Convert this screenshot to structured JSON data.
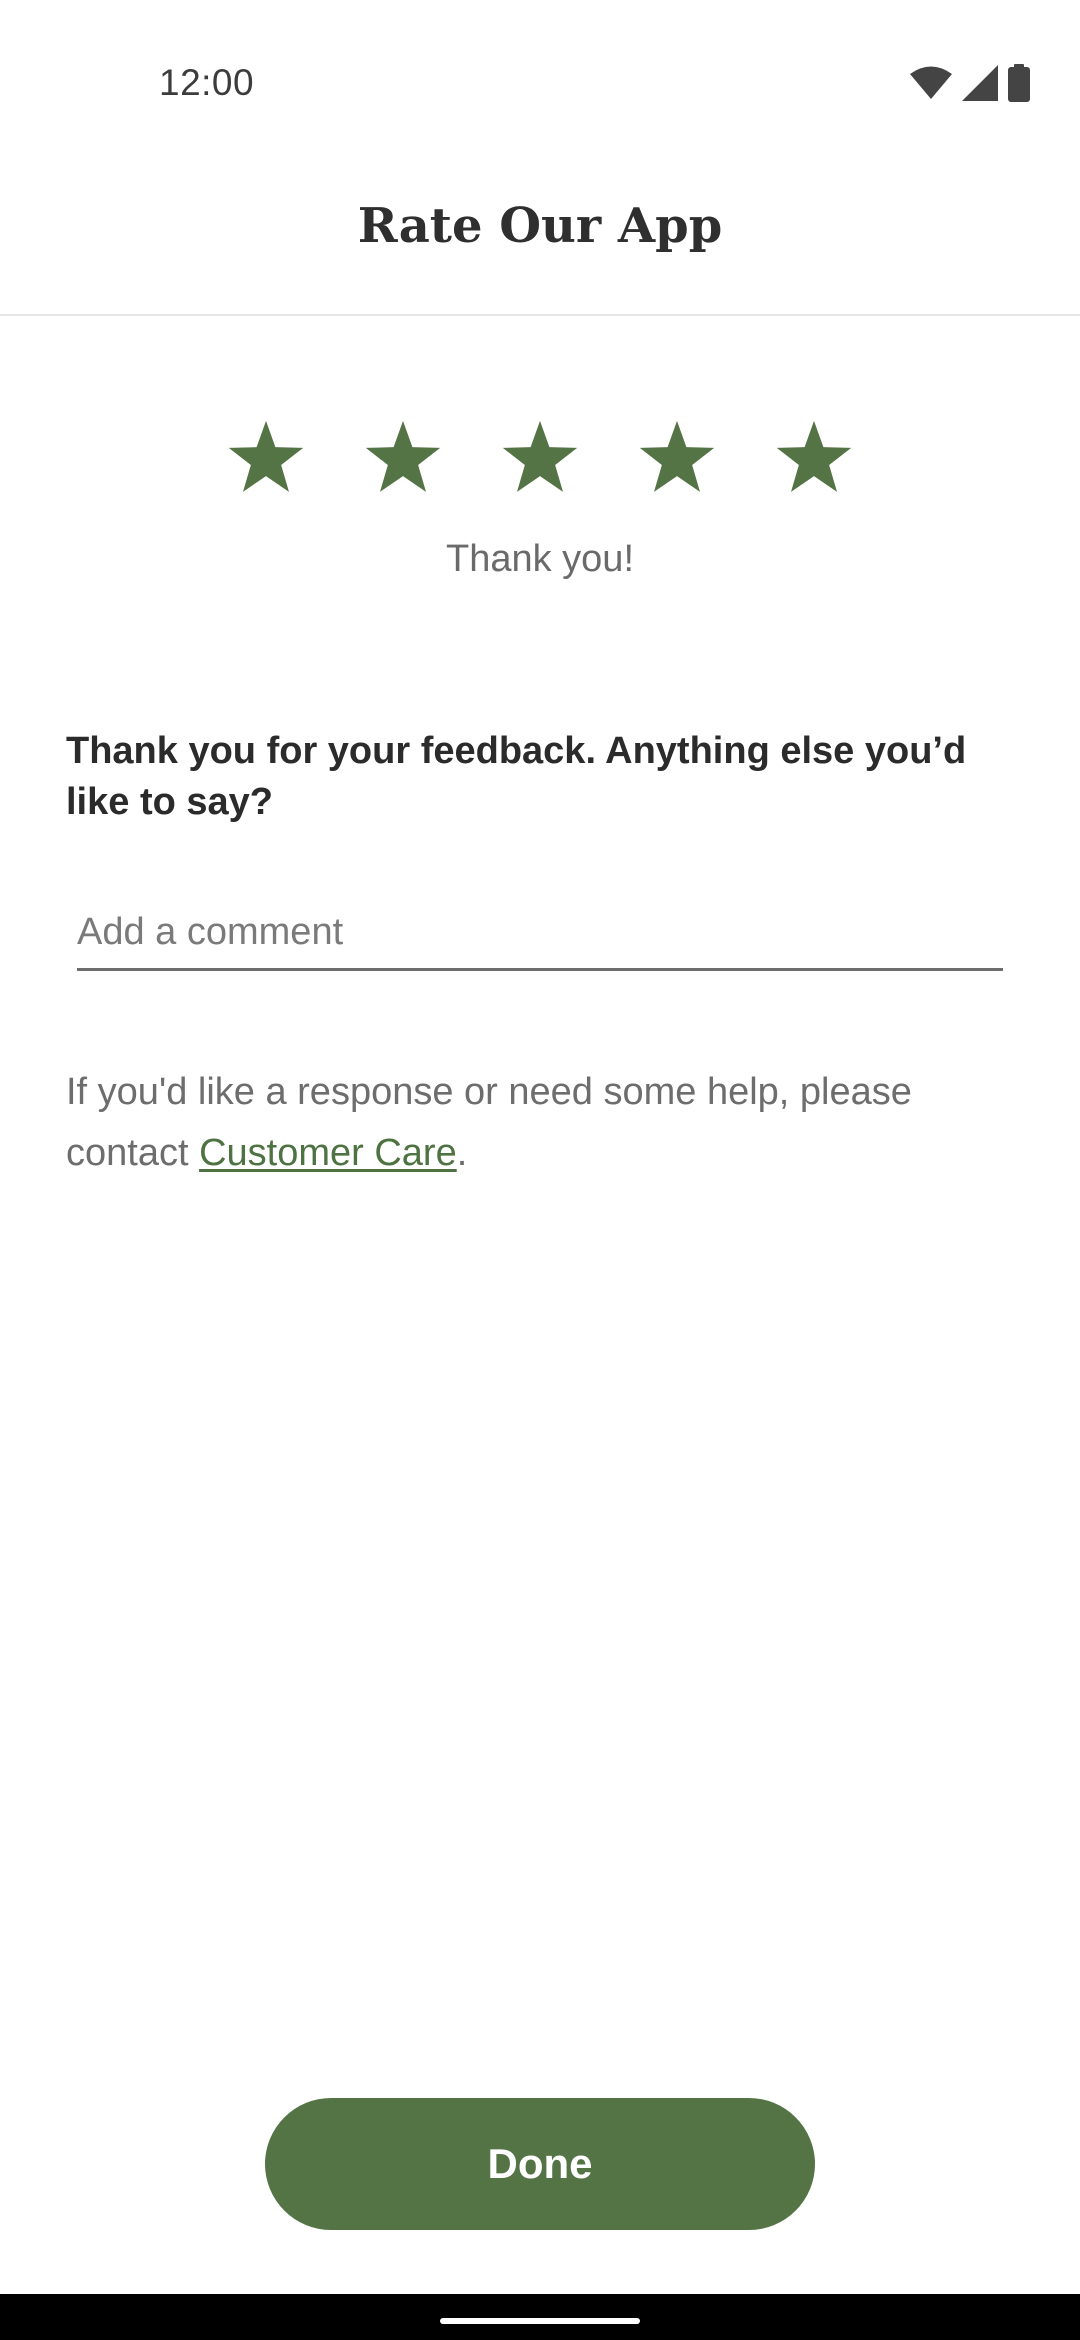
{
  "status_bar": {
    "time": "12:00",
    "icons": [
      "wifi-icon",
      "cellular-signal-icon",
      "battery-icon"
    ]
  },
  "header": {
    "title": "Rate Our App"
  },
  "rating": {
    "selected": 5,
    "max": 5,
    "star_color": "#547445",
    "caption": "Thank you!"
  },
  "feedback": {
    "prompt": "Thank you for your feedback. Anything else you’d like to say?",
    "comment_placeholder": "Add a comment",
    "comment_value": ""
  },
  "help": {
    "text_before": "If you'd like a response or need some help, please contact ",
    "link_label": "Customer Care",
    "text_after": "."
  },
  "actions": {
    "done_label": "Done"
  },
  "colors": {
    "accent": "#547445",
    "link": "#4f7243"
  }
}
